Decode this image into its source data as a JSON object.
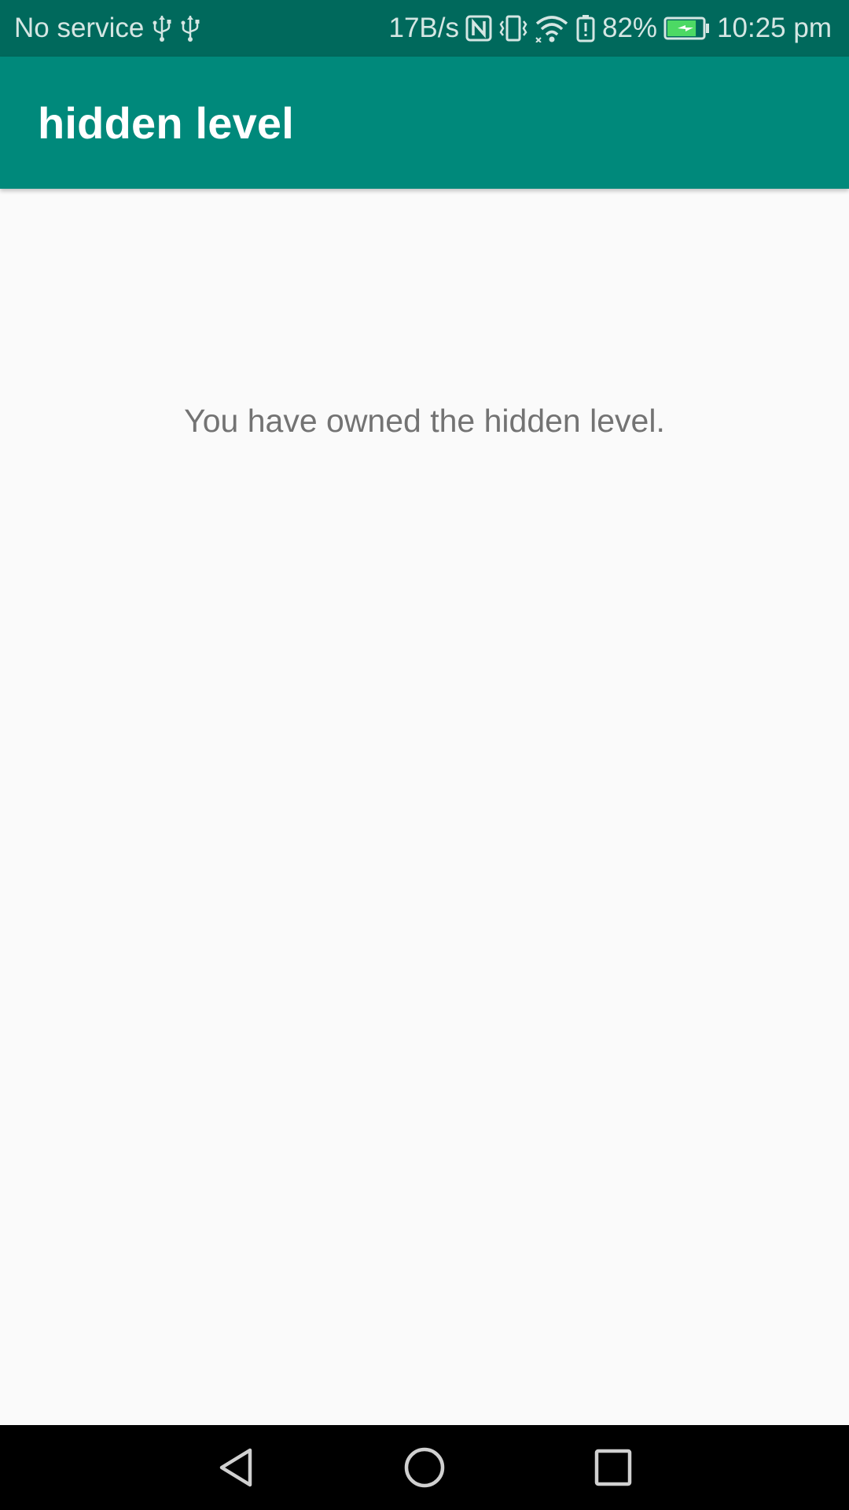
{
  "status_bar": {
    "carrier": "No service",
    "net_speed": "17B/s",
    "battery_percent": "82%",
    "time": "10:25 pm",
    "icons": [
      "usb-icon",
      "usb-icon",
      "nfc-icon",
      "vibrate-icon",
      "wifi-icon",
      "battery-alert-icon",
      "battery-charging-icon"
    ],
    "battery_level": 0.82,
    "battery_color": "#4cd964"
  },
  "app_bar": {
    "title": "hidden level",
    "color": "#00897b"
  },
  "content": {
    "message": "You have owned the hidden level."
  },
  "nav_bar": {
    "icons": [
      "back-icon",
      "home-icon",
      "recents-icon"
    ]
  }
}
